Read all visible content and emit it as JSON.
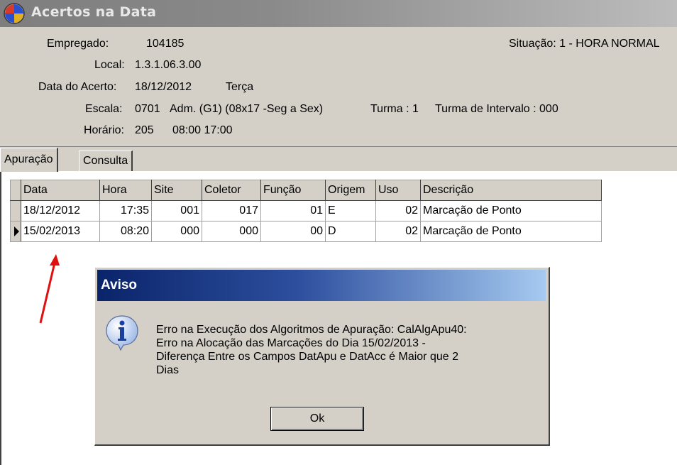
{
  "window": {
    "title": "Acertos na Data"
  },
  "header": {
    "empregado_label": "Empregado:",
    "empregado_value": "104185",
    "situacao": "Situação: 1 - HORA NORMAL",
    "local_label": "Local:",
    "local_value": "1.3.1.06.3.00",
    "data_label": "Data do Acerto:",
    "data_value": "18/12/2012",
    "data_day": "Terça",
    "escala_label": "Escala:",
    "escala_value": "0701",
    "escala_desc": "Adm. (G1) (08x17 -Seg a Sex)",
    "turma": "Turma : 1",
    "turma_intervalo": "Turma de Intervalo : 000",
    "horario_label": "Horário:",
    "horario_value": "205",
    "horario_times": "08:00 17:00"
  },
  "tabs": [
    {
      "label": "Apuração",
      "active": true
    },
    {
      "label": "Consulta",
      "active": false
    }
  ],
  "grid": {
    "columns": [
      "Data",
      "Hora",
      "Site",
      "Coletor",
      "Função",
      "Origem",
      "Uso",
      "Descrição"
    ],
    "rows": [
      {
        "data": "18/12/2012",
        "hora": "17:35",
        "site": "001",
        "coletor": "017",
        "funcao": "01",
        "origem": "E",
        "uso": "02",
        "descricao": "Marcação de Ponto",
        "current": false
      },
      {
        "data": "15/02/2013",
        "hora": "08:20",
        "site": "000",
        "coletor": "000",
        "funcao": "00",
        "origem": "D",
        "uso": "02",
        "descricao": "Marcação de Ponto",
        "current": true
      }
    ]
  },
  "dialog": {
    "title": "Aviso",
    "message_lines": [
      "Erro na Execução dos Algoritmos de Apuração: CalAlgApu40:",
      "Erro na Alocação das Marcações do Dia 15/02/2013 -",
      "Diferença Entre os Campos DatApu e DatAcc é Maior que 2",
      "Dias"
    ],
    "ok_label": "Ok",
    "icon": "info-icon"
  },
  "annotation": {
    "color": "#ff0000",
    "icon": "red-arrow"
  }
}
